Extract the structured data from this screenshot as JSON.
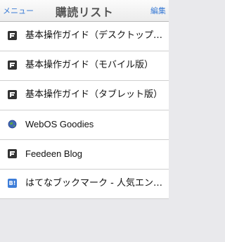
{
  "navbar": {
    "menu_label": "メニュー",
    "title": "購読リスト",
    "edit_label": "編集"
  },
  "feeds": [
    {
      "label": "基本操作ガイド（デスクトップ版）",
      "icon": "feedeen-icon"
    },
    {
      "label": "基本操作ガイド（モバイル版）",
      "icon": "feedeen-icon"
    },
    {
      "label": "基本操作ガイド（タブレット版）",
      "icon": "feedeen-icon"
    },
    {
      "label": "WebOS Goodies",
      "icon": "globe-icon"
    },
    {
      "label": "Feedeen Blog",
      "icon": "feedeen-icon"
    },
    {
      "label": "はてなブックマーク - 人気エントリー",
      "icon": "hatena-bookmark-icon",
      "icon_text": "B!"
    }
  ],
  "colors": {
    "accent": "#3a7bd5",
    "background": "#e9e9ec",
    "hatena_blue": "#3d7dd8"
  }
}
